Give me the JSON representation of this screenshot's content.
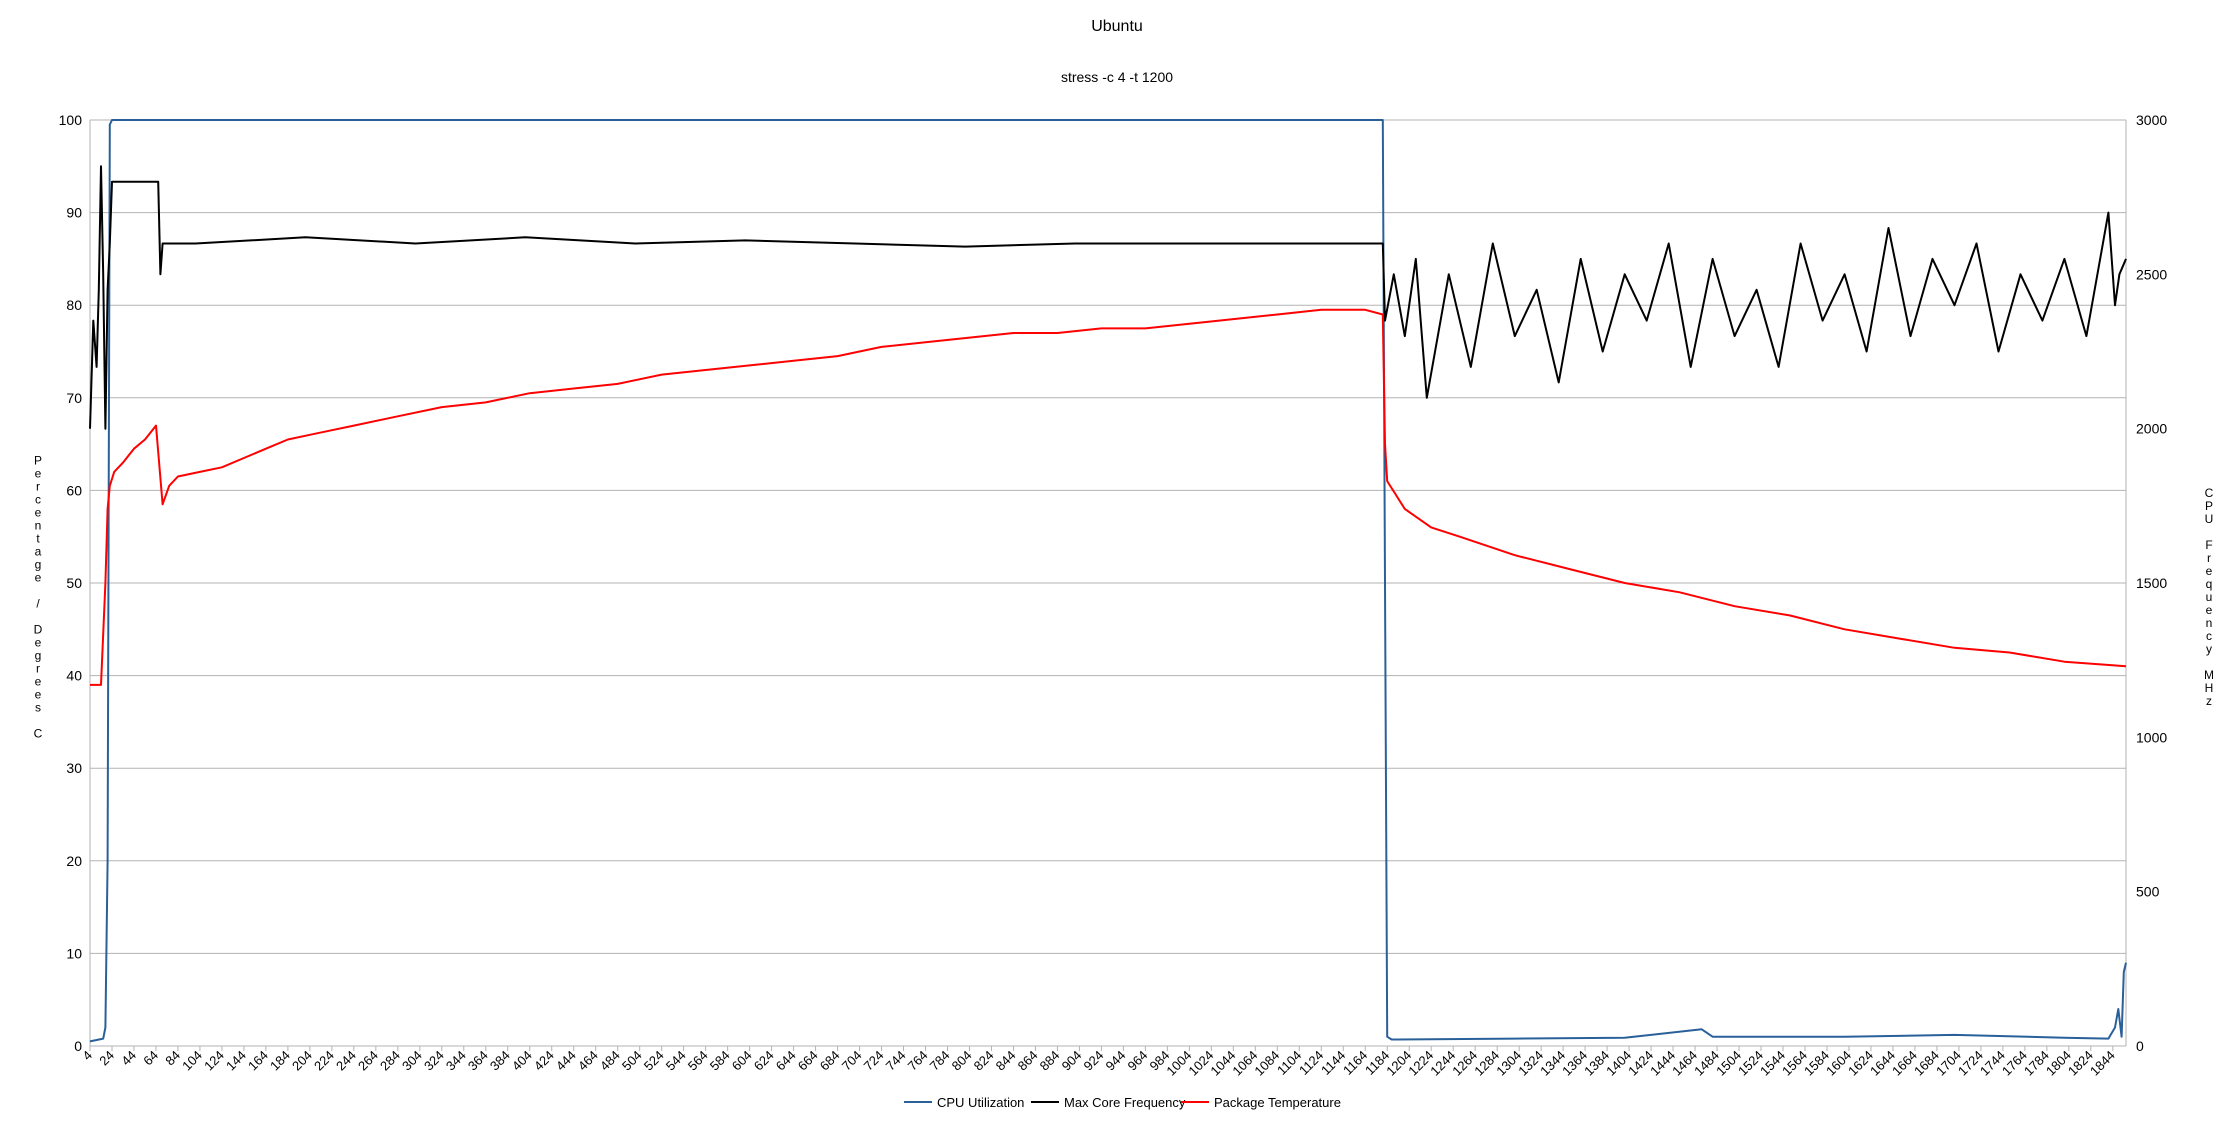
{
  "chart_data": {
    "type": "line",
    "title": "Ubuntu",
    "subtitle": "stress -c 4 -t 1200",
    "ylabel_left": "Percentage / Degrees C",
    "ylabel_right": "CPU Frequency MHz",
    "ylim_left": [
      0,
      100
    ],
    "yticks_left": [
      0,
      10,
      20,
      30,
      40,
      50,
      60,
      70,
      80,
      90,
      100
    ],
    "ylim_right": [
      0,
      3000
    ],
    "yticks_right": [
      0,
      500,
      1000,
      1500,
      2000,
      2500,
      3000
    ],
    "xlim": [
      4,
      1856
    ],
    "xticks": [
      4,
      24,
      44,
      64,
      84,
      104,
      124,
      144,
      164,
      184,
      204,
      224,
      244,
      264,
      284,
      304,
      324,
      344,
      364,
      384,
      404,
      424,
      444,
      464,
      484,
      504,
      524,
      544,
      564,
      584,
      604,
      624,
      644,
      664,
      684,
      704,
      724,
      744,
      764,
      784,
      804,
      824,
      844,
      864,
      884,
      904,
      924,
      944,
      964,
      984,
      1004,
      1024,
      1044,
      1064,
      1084,
      1104,
      1124,
      1144,
      1164,
      1184,
      1204,
      1224,
      1244,
      1264,
      1284,
      1304,
      1324,
      1344,
      1364,
      1384,
      1404,
      1424,
      1444,
      1464,
      1484,
      1504,
      1524,
      1544,
      1564,
      1584,
      1604,
      1624,
      1644,
      1664,
      1684,
      1704,
      1724,
      1744,
      1764,
      1784,
      1804,
      1824,
      1844
    ],
    "grid": true,
    "legend_position": "bottom",
    "series": [
      {
        "name": "CPU Utilization",
        "color": "#2a6099",
        "axis": "left",
        "x": [
          4,
          16,
          18,
          20,
          22,
          24,
          100,
          300,
          600,
          900,
          1100,
          1170,
          1180,
          1182,
          1184,
          1188,
          1300,
          1400,
          1470,
          1480,
          1600,
          1700,
          1800,
          1840,
          1846,
          1849,
          1852,
          1854,
          1856
        ],
        "y": [
          0.5,
          0.8,
          2,
          20,
          99.5,
          100,
          100,
          100,
          100,
          100,
          100,
          100,
          100,
          50,
          1,
          0.7,
          0.8,
          0.9,
          1.8,
          1,
          1,
          1.2,
          0.9,
          0.8,
          2,
          4,
          1,
          8,
          9
        ]
      },
      {
        "name": "Max Core Frequency",
        "color": "#000000",
        "axis": "right",
        "x": [
          4,
          7,
          10,
          12,
          14,
          16,
          18,
          20,
          22,
          24,
          66,
          68,
          70,
          100,
          200,
          300,
          400,
          500,
          600,
          700,
          800,
          900,
          1000,
          1100,
          1180,
          1182,
          1190,
          1200,
          1210,
          1220,
          1240,
          1260,
          1280,
          1300,
          1320,
          1340,
          1360,
          1380,
          1400,
          1420,
          1440,
          1460,
          1480,
          1500,
          1520,
          1540,
          1560,
          1580,
          1600,
          1620,
          1640,
          1660,
          1680,
          1700,
          1720,
          1740,
          1760,
          1780,
          1800,
          1820,
          1840,
          1846,
          1850,
          1856
        ],
        "y": [
          2000,
          2350,
          2200,
          2450,
          2850,
          2500,
          2000,
          2450,
          2600,
          2800,
          2800,
          2500,
          2600,
          2600,
          2620,
          2600,
          2620,
          2600,
          2610,
          2600,
          2590,
          2600,
          2600,
          2600,
          2600,
          2350,
          2500,
          2300,
          2550,
          2100,
          2500,
          2200,
          2600,
          2300,
          2450,
          2150,
          2550,
          2250,
          2500,
          2350,
          2600,
          2200,
          2550,
          2300,
          2450,
          2200,
          2600,
          2350,
          2500,
          2250,
          2650,
          2300,
          2550,
          2400,
          2600,
          2250,
          2500,
          2350,
          2550,
          2300,
          2700,
          2400,
          2500,
          2550
        ]
      },
      {
        "name": "Package Temperature",
        "color": "#ff0000",
        "axis": "left",
        "x": [
          4,
          14,
          18,
          20,
          22,
          26,
          34,
          44,
          54,
          64,
          70,
          76,
          84,
          104,
          124,
          144,
          164,
          184,
          204,
          224,
          244,
          284,
          324,
          364,
          404,
          444,
          484,
          524,
          564,
          604,
          644,
          684,
          724,
          764,
          804,
          844,
          884,
          924,
          964,
          1004,
          1044,
          1084,
          1124,
          1164,
          1180,
          1182,
          1184,
          1200,
          1224,
          1250,
          1300,
          1350,
          1400,
          1450,
          1500,
          1550,
          1600,
          1650,
          1700,
          1750,
          1800,
          1856
        ],
        "y": [
          39,
          39,
          50,
          58,
          60.5,
          62,
          63,
          64.5,
          65.5,
          67,
          58.5,
          60.5,
          61.5,
          62,
          62.5,
          63.5,
          64.5,
          65.5,
          66,
          66.5,
          67,
          68,
          69,
          69.5,
          70.5,
          71,
          71.5,
          72.5,
          73,
          73.5,
          74,
          74.5,
          75.5,
          76,
          76.5,
          77,
          77,
          77.5,
          77.5,
          78,
          78.5,
          79,
          79.5,
          79.5,
          79,
          65,
          61,
          58,
          56,
          55,
          53,
          51.5,
          50,
          49,
          47.5,
          46.5,
          45,
          44,
          43,
          42.5,
          41.5,
          41
        ]
      }
    ]
  }
}
